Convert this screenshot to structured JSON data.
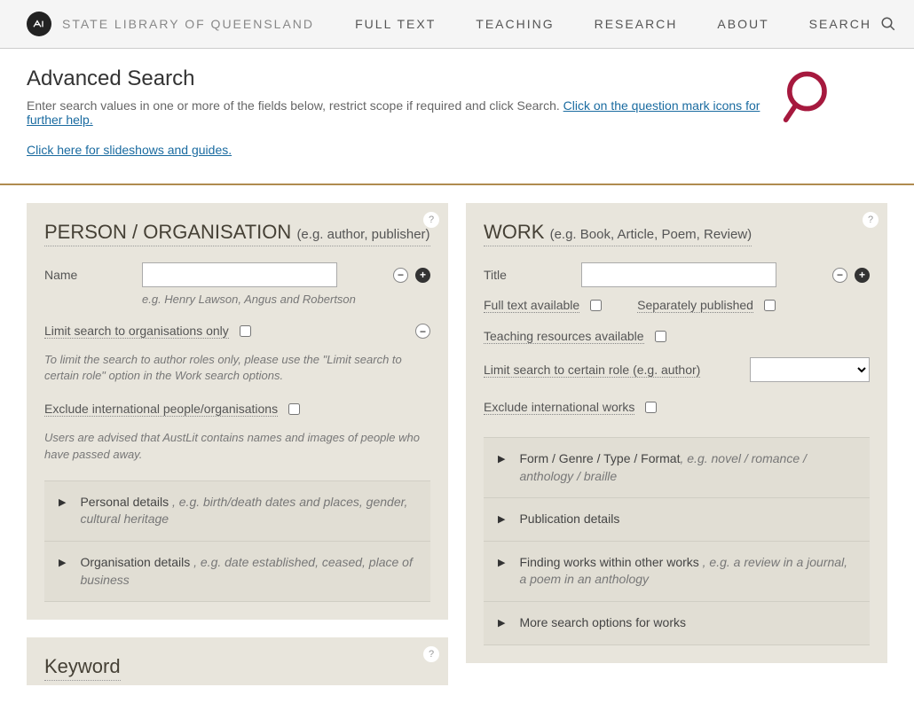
{
  "topbar": {
    "site_name": "STATE LIBRARY OF QUEENSLAND",
    "nav": [
      "FULL TEXT",
      "TEACHING",
      "RESEARCH",
      "ABOUT"
    ],
    "search_label": "SEARCH"
  },
  "header": {
    "title": "Advanced Search",
    "subtitle_plain": "Enter search values in one or more of the fields below, restrict scope if required and click Search. ",
    "subtitle_link": "Click on the question mark icons for further help.",
    "slideshow_link": "Click here for slideshows and guides."
  },
  "person_panel": {
    "title": "PERSON / ORGANISATION",
    "title_hint": "(e.g. author, publisher)",
    "name_label": "Name",
    "name_hint": "e.g. Henry Lawson, Angus and Robertson",
    "limit_org_label": "Limit search to organisations only",
    "role_note": "To limit the search to author roles only, please use the \"Limit search to certain role\" option in the Work search options.",
    "exclude_intl_label": "Exclude international people/organisations",
    "advice": "Users are advised that AustLit contains names and images of people who have passed away.",
    "collapsed": [
      {
        "title": "Personal details ",
        "eg": ", e.g. birth/death dates and places, gender, cultural heritage"
      },
      {
        "title": "Organisation details ",
        "eg": ", e.g. date established, ceased, place of business"
      }
    ]
  },
  "keyword_panel": {
    "title": "Keyword"
  },
  "work_panel": {
    "title": "WORK",
    "title_hint": "(e.g. Book, Article, Poem, Review)",
    "title_field_label": "Title",
    "fulltext_label": "Full text available",
    "separately_label": "Separately published",
    "teaching_label": "Teaching resources available",
    "role_limit_label": "Limit search to certain role (e.g. author)",
    "exclude_intl_label": "Exclude international works",
    "collapsed": [
      {
        "title": "Form / Genre / Type / Format",
        "eg": ", e.g. novel / romance / anthology / braille"
      },
      {
        "title": "Publication details",
        "eg": ""
      },
      {
        "title": "Finding works within other works ",
        "eg": ", e.g. a review in a journal, a poem in an anthology"
      },
      {
        "title": "More search options for works",
        "eg": ""
      }
    ]
  }
}
